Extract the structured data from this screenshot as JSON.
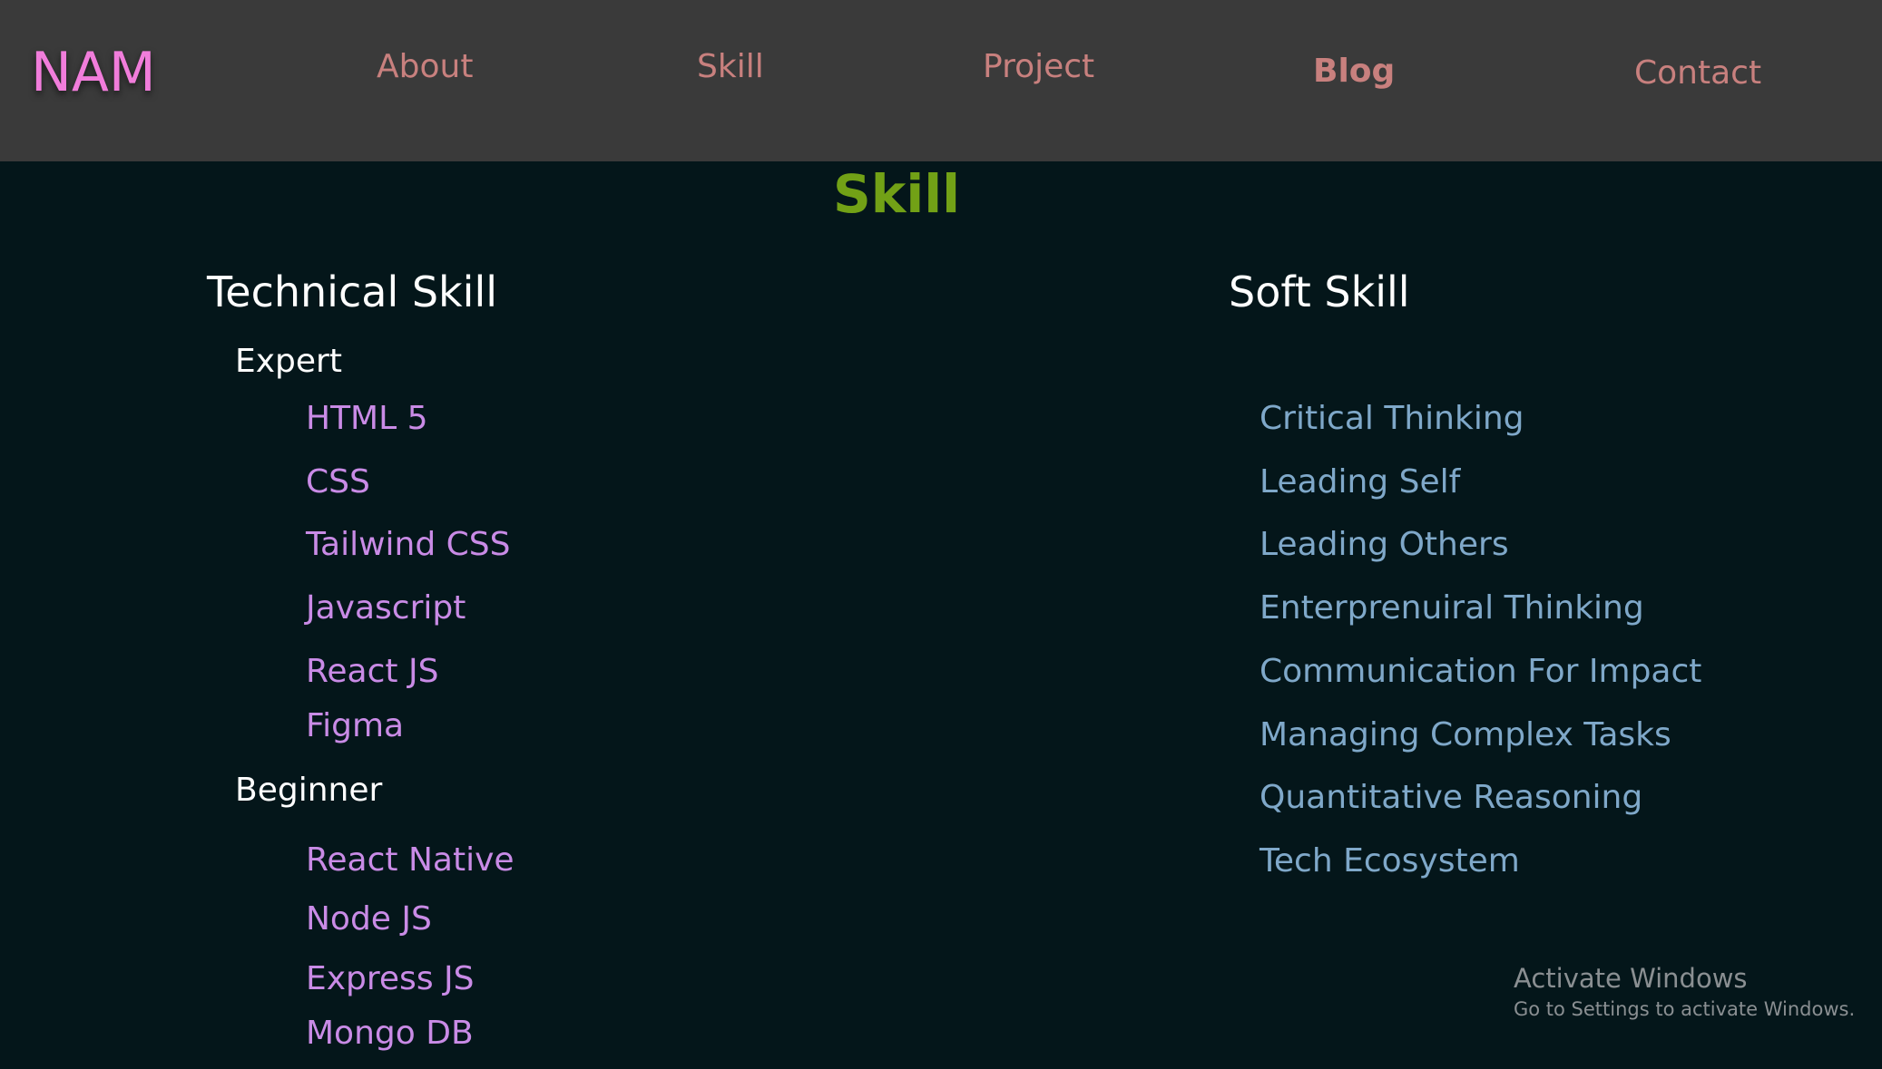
{
  "header": {
    "logo": "NAM",
    "nav": {
      "about": "About",
      "skill": "Skill",
      "project": "Project",
      "blog": "Blog",
      "contact": "Contact"
    }
  },
  "main": {
    "title": "Skill",
    "technical": {
      "heading": "Technical Skill",
      "expert_label": "Expert",
      "expert": [
        "HTML 5",
        "CSS",
        "Tailwind CSS",
        "Javascript",
        "React JS",
        "Figma"
      ],
      "beginner_label": "Beginner",
      "beginner": [
        "React Native",
        "Node JS",
        "Express JS",
        "Mongo DB"
      ]
    },
    "soft": {
      "heading": "Soft Skill",
      "items": [
        "Critical Thinking",
        "Leading Self",
        "Leading Others",
        "Enterprenuiral Thinking",
        "Communication For Impact",
        "Managing Complex Tasks",
        "Quantitative Reasoning",
        "Tech Ecosystem"
      ]
    }
  },
  "watermark": {
    "title": "Activate Windows",
    "subtitle": "Go to Settings to activate Windows."
  },
  "colors": {
    "header_bg": "#3a3a3a",
    "page_bg": "#04161a",
    "logo": "#f17ddb",
    "nav": "#c8807e",
    "title": "#72a116",
    "technical_item": "#c98be6",
    "soft_item": "#7fa8c9"
  }
}
